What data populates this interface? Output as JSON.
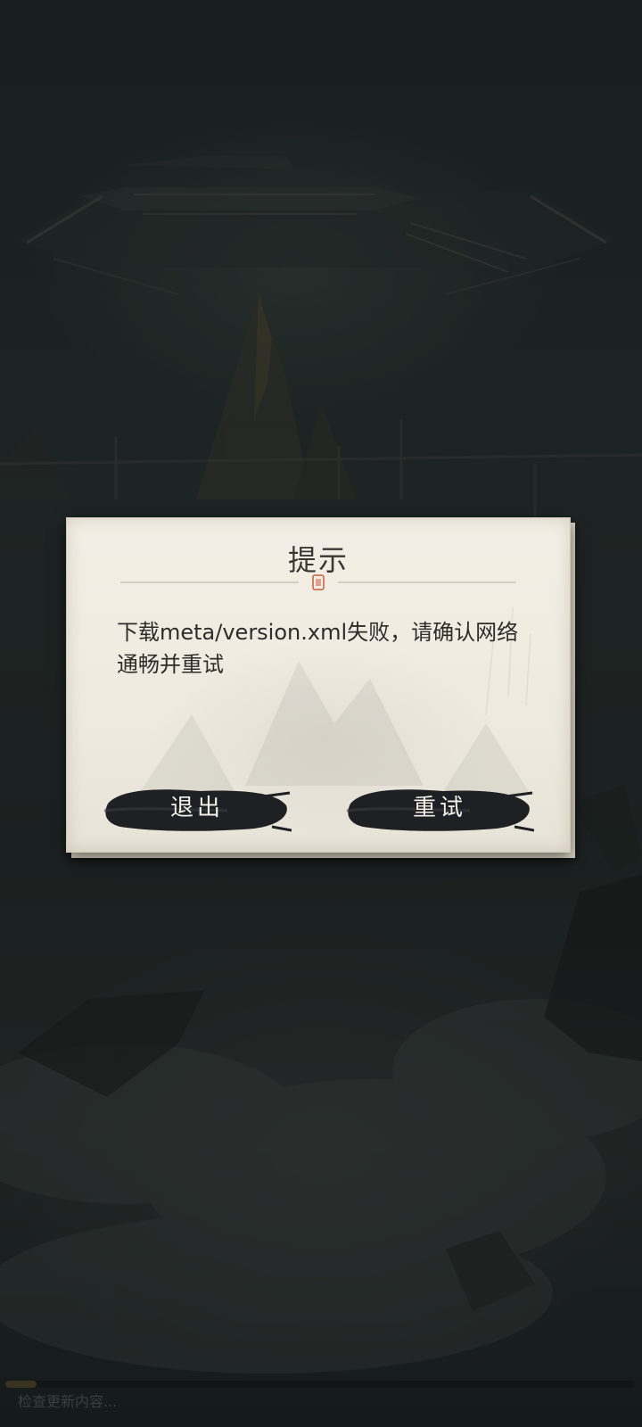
{
  "dialog": {
    "title": "提示",
    "message": "下载meta/version.xml失败，请确认网络通畅并重试",
    "exit_label": "退出",
    "retry_label": "重试"
  },
  "loading": {
    "status": "检查更新内容...",
    "progress": 0.05
  },
  "colors": {
    "paper": "#eeeadf",
    "ink": "#1c1c1e",
    "seal": "#c8603a"
  }
}
